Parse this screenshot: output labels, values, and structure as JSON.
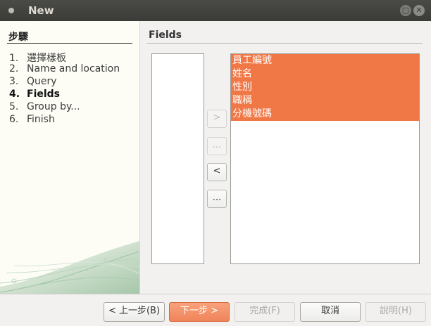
{
  "window": {
    "title": "New"
  },
  "sidebar": {
    "title": "步驟",
    "steps": [
      {
        "num": "1.",
        "label": "選擇樣板"
      },
      {
        "num": "2.",
        "label": "Name and location"
      },
      {
        "num": "3.",
        "label": "Query"
      },
      {
        "num": "4.",
        "label": "Fields"
      },
      {
        "num": "5.",
        "label": "Group by..."
      },
      {
        "num": "6.",
        "label": "Finish"
      }
    ]
  },
  "main": {
    "title": "Fields",
    "available_fields": [],
    "selected_fields": [
      "員工編號",
      "姓名",
      "性別",
      "職稱",
      " 分機號碼"
    ],
    "move_buttons": {
      "add": ">",
      "add_all": "...",
      "remove": "<",
      "remove_all": "..."
    }
  },
  "footer": {
    "back": "< 上一步(B)",
    "next": "下一步 >",
    "finish": "完成(F)",
    "cancel": "取消",
    "help": "說明(H)"
  },
  "colors": {
    "accent": "#f07746",
    "titlebar": "#3c3b37"
  }
}
